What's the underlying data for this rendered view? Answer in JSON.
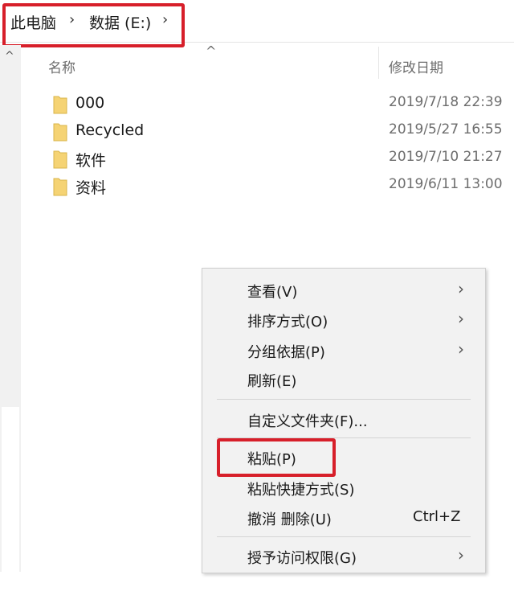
{
  "breadcrumb": {
    "items": [
      "此电脑",
      "数据 (E:)"
    ],
    "separator": "›"
  },
  "columns": {
    "name": "名称",
    "modified": "修改日期"
  },
  "files": [
    {
      "name": "000",
      "modified": "2019/7/18 22:39"
    },
    {
      "name": "Recycled",
      "modified": "2019/5/27 16:55"
    },
    {
      "name": "软件",
      "modified": "2019/7/10 21:27"
    },
    {
      "name": "资料",
      "modified": "2019/6/11 13:00"
    }
  ],
  "context_menu": {
    "view": "查看(V)",
    "sort_by": "排序方式(O)",
    "group_by": "分组依据(P)",
    "refresh": "刷新(E)",
    "customize_folder": "自定义文件夹(F)...",
    "paste": "粘贴(P)",
    "paste_shortcut": "粘贴快捷方式(S)",
    "undo_delete": "撤消 删除(U)",
    "undo_shortcut": "Ctrl+Z",
    "give_access": "授予访问权限(G)"
  },
  "icons": {
    "chevron": "›",
    "submenu_arrow": "〉",
    "sort_up": "^",
    "scroll_up": "^"
  },
  "colors": {
    "highlight": "#d71f2a",
    "folder": "#f5d374",
    "menu_bg": "#f2f2f2"
  }
}
